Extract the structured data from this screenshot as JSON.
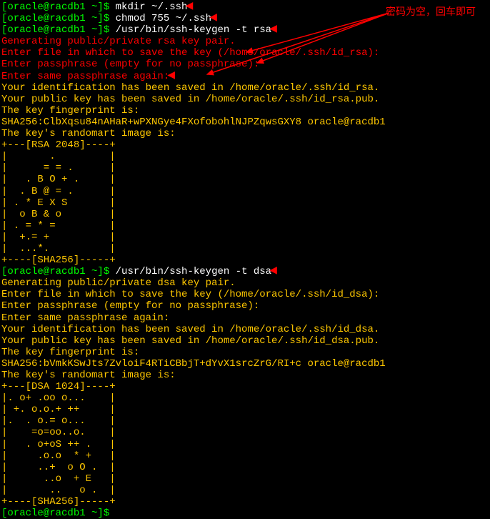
{
  "annotation": "密码为空，回车即可",
  "p1": "[oracle@racdb1 ~]$ ",
  "cmd1": "mkdir ~/.ssh",
  "cmd2": "chmod 755 ~/.ssh",
  "cmd3": "/usr/bin/ssh-keygen -t rsa",
  "rsa": {
    "l1": "Generating public/private rsa key pair.",
    "l2a": "Enter file in which to save the key (",
    "l2b": "/home/oracle/.ssh/id_rsa",
    "l2c": "):",
    "l3": "Enter passphrase (empty for no passphrase):",
    "l4": "Enter same passphrase again:",
    "l5": "Your identification has been saved in /home/oracle/.ssh/id_rsa.",
    "l6": "Your public key has been saved in /home/oracle/.ssh/id_rsa.pub.",
    "l7": "The key fingerprint is:",
    "l8": "SHA256:ClbXqsu84nAHaR+wPXNGye4FXofobohlNJPZqwsGXY8 oracle@racdb1",
    "l9": "The key's randomart image is:",
    "art": [
      "+---[RSA 2048]----+",
      "|       .         |",
      "|      = = .      |",
      "|   . B O + .     |",
      "|  . B @ = .      |",
      "| . * E X S       |",
      "|  o B & o        |",
      "| . = * =         |",
      "|  +.= +          |",
      "|  ...*.          |",
      "+----[SHA256]-----+"
    ]
  },
  "cmd4": "/usr/bin/ssh-keygen -t dsa",
  "dsa": {
    "l1": "Generating public/private dsa key pair.",
    "l2": "Enter file in which to save the key (/home/oracle/.ssh/id_dsa):",
    "l3": "Enter passphrase (empty for no passphrase):",
    "l4": "Enter same passphrase again:",
    "l5": "Your identification has been saved in /home/oracle/.ssh/id_dsa.",
    "l6": "Your public key has been saved in /home/oracle/.ssh/id_dsa.pub.",
    "l7": "The key fingerprint is:",
    "l8": "SHA256:bVmkKSwJts7ZvloiF4RTiCBbjT+dYvX1srcZrG/RI+c oracle@racdb1",
    "l9": "The key's randomart image is:",
    "art": [
      "+---[DSA 1024]----+",
      "|. o+ .oo o...    |",
      "| +. o.o.+ ++     |",
      "|.  . o.= o...    |",
      "|    =o=oo..o.    |",
      "|   . o+oS ++ .   |",
      "|     .o.o  * +   |",
      "|     ..+  o O .  |",
      "|      ..o  + E   |",
      "|       ..   o .  |",
      "+----[SHA256]-----+"
    ]
  },
  "marker": "◀"
}
